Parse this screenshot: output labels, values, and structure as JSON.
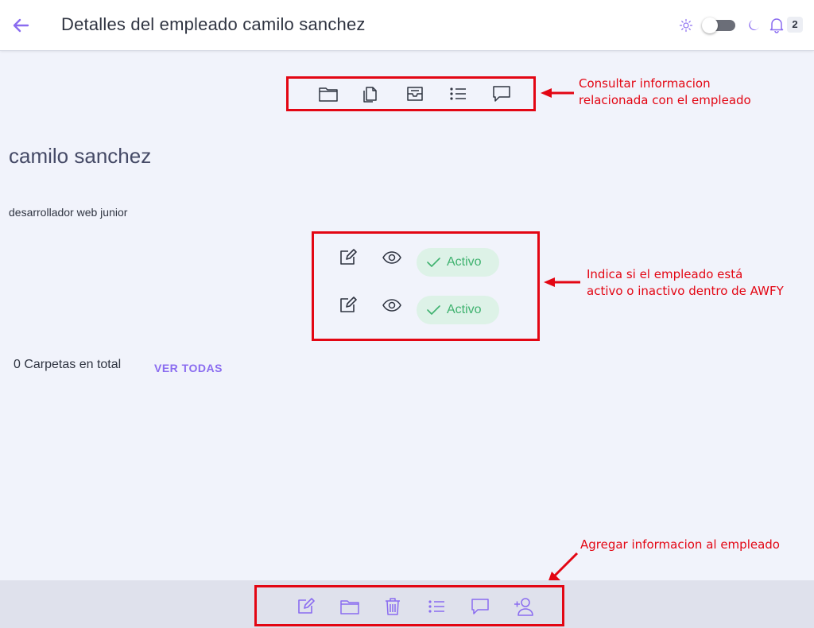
{
  "header": {
    "title": "Detalles del empleado camilo sanchez",
    "notification_count": "2"
  },
  "employee": {
    "name": "camilo sanchez",
    "role": "desarrollador web junior"
  },
  "status_rows": [
    {
      "label": "Activo"
    },
    {
      "label": "Activo"
    }
  ],
  "folders": {
    "total_text": "0 Carpetas en total",
    "view_all": "VER TODAS"
  },
  "annotations": {
    "top_line1": "Consultar informacion",
    "top_line2": "relacionada con el empleado",
    "status_line1": "Indica si el empleado está",
    "status_line2": "activo o inactivo dentro de AWFY",
    "bottom": "Agregar informacion al empleado"
  },
  "colors": {
    "accent": "#8a6cf0",
    "annotation_red": "#e30613",
    "status_green": "#3fb26f",
    "status_bg": "#ddf2e7"
  },
  "icons": {
    "header": [
      "back-arrow-icon",
      "sun-icon",
      "theme-toggle",
      "moon-icon",
      "bell-icon"
    ],
    "top_toolbar": [
      "folder-icon",
      "documents-icon",
      "inbox-icon",
      "list-icon",
      "comment-icon"
    ],
    "status_actions": [
      "edit-icon",
      "eye-icon"
    ],
    "bottom_toolbar": [
      "edit-icon",
      "folder-icon",
      "trash-icon",
      "list-icon",
      "comment-icon",
      "add-user-icon"
    ]
  }
}
